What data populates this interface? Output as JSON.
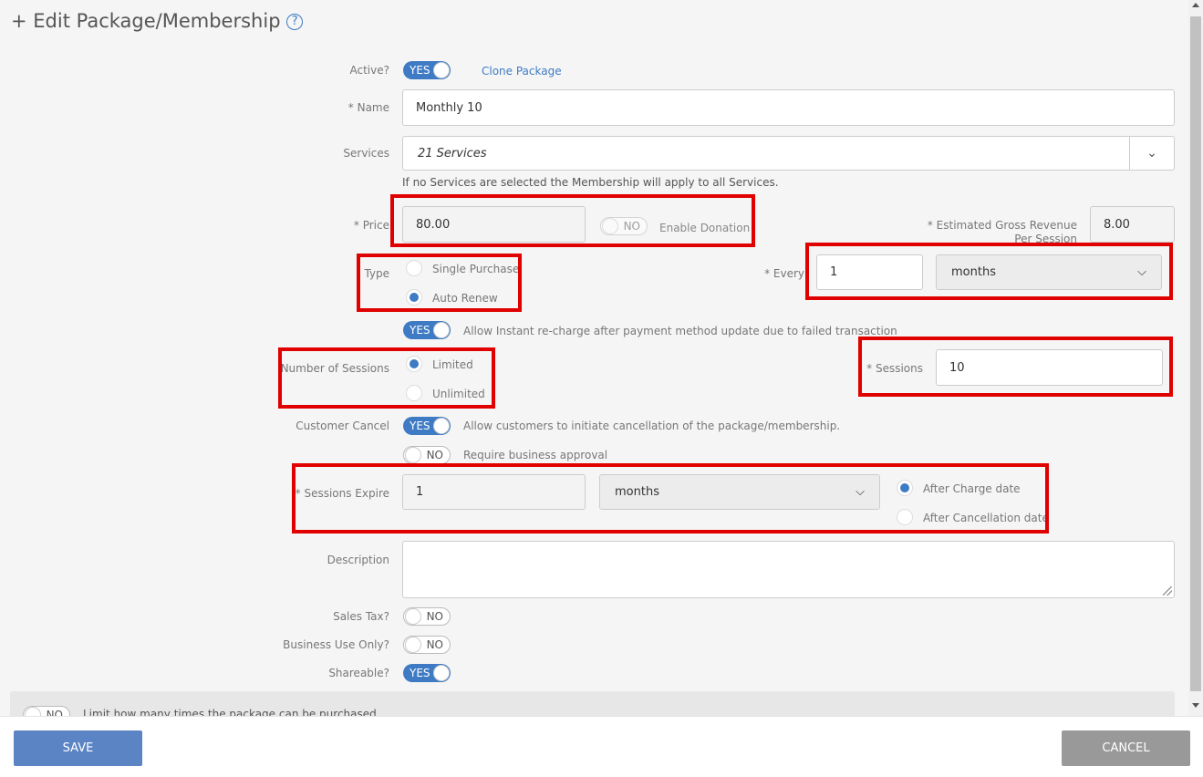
{
  "header": {
    "title": "+ Edit Package/Membership",
    "help_icon": "?"
  },
  "active": {
    "label": "Active?",
    "toggle": "YES",
    "clone_link": "Clone Package"
  },
  "name": {
    "label": "* Name",
    "value": "Monthly 10"
  },
  "services": {
    "label": "Services",
    "value": "21 Services",
    "hint": "If no Services are selected the Membership will apply to all Services."
  },
  "price": {
    "label": "* Price",
    "value": "80.00",
    "donation_toggle": "NO",
    "donation_label": "Enable Donation"
  },
  "estimated": {
    "label": "* Estimated Gross Revenue Per Session",
    "value": "8.00"
  },
  "type": {
    "label": "Type",
    "options": [
      "Single Purchase",
      "Auto Renew"
    ],
    "selected": "Auto Renew"
  },
  "every": {
    "label": "* Every",
    "value": "1",
    "unit": "months"
  },
  "recharge": {
    "toggle": "YES",
    "text": "Allow Instant re-charge after payment method update due to failed transaction"
  },
  "sessions_count": {
    "label": "Number of Sessions",
    "options": [
      "Limited",
      "Unlimited"
    ],
    "selected": "Limited"
  },
  "sessions": {
    "label": "* Sessions",
    "value": "10"
  },
  "customer_cancel": {
    "label": "Customer Cancel",
    "toggle": "YES",
    "text": "Allow customers to initiate cancellation of the package/membership.",
    "approval_toggle": "NO",
    "approval_text": "Require business approval"
  },
  "sessions_expire": {
    "label": "* Sessions Expire",
    "value": "1",
    "unit": "months",
    "options": [
      "After Charge date",
      "After Cancellation date"
    ],
    "selected": "After Charge date"
  },
  "description": {
    "label": "Description",
    "value": ""
  },
  "sales_tax": {
    "label": "Sales Tax?",
    "toggle": "NO"
  },
  "business_use": {
    "label": "Business Use Only?",
    "toggle": "NO"
  },
  "shareable": {
    "label": "Shareable?",
    "toggle": "YES"
  },
  "limit": {
    "toggle": "NO",
    "text": "Limit how many times the package can be purchased"
  },
  "footer": {
    "save": "SAVE",
    "cancel": "CANCEL"
  },
  "colors": {
    "accent": "#3e7bc4",
    "save_button": "#5b84c4",
    "cancel_button": "#999999",
    "highlight": "#e00000"
  }
}
